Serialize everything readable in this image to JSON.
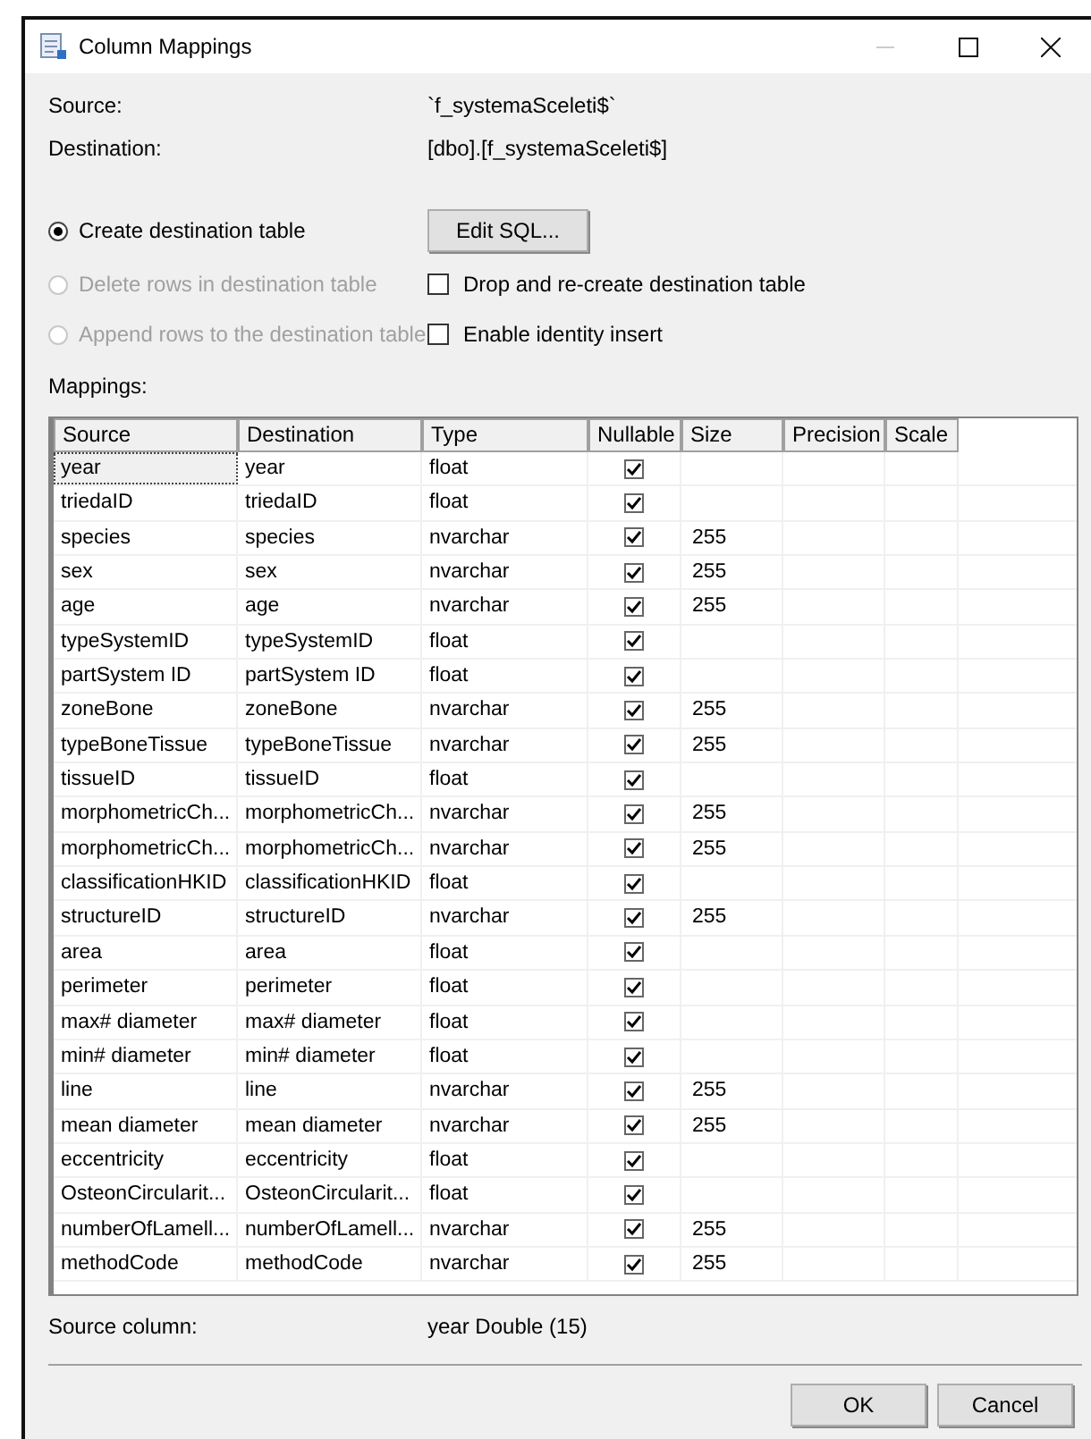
{
  "window": {
    "title": "Column Mappings"
  },
  "source": {
    "label": "Source:",
    "value": "`f_systemaSceleti$`"
  },
  "destination": {
    "label": "Destination:",
    "value": "[dbo].[f_systemaSceleti$]"
  },
  "options": [
    {
      "kind": "radio",
      "label": "Create destination table",
      "selected": true,
      "disabled": false
    },
    {
      "kind": "button",
      "label": "Edit SQL..."
    },
    {
      "kind": "radio",
      "label": "Delete rows in destination table",
      "selected": false,
      "disabled": true
    },
    {
      "kind": "checkbox",
      "label": "Drop and re-create destination table",
      "checked": false
    },
    {
      "kind": "radio",
      "label": "Append rows to the destination table",
      "selected": false,
      "disabled": true
    },
    {
      "kind": "checkbox",
      "label": "Enable identity insert",
      "checked": false
    }
  ],
  "mappings_label": "Mappings:",
  "table": {
    "columns": [
      "Source",
      "Destination",
      "Type",
      "Nullable",
      "Size",
      "Precision",
      "Scale"
    ],
    "rows": [
      {
        "source": "year",
        "destination": "year",
        "type": "float",
        "nullable": true,
        "size": "",
        "selected": true
      },
      {
        "source": "triedaID",
        "destination": "triedaID",
        "type": "float",
        "nullable": true,
        "size": "",
        "selected": false
      },
      {
        "source": "species",
        "destination": "species",
        "type": "nvarchar",
        "nullable": true,
        "size": "255",
        "selected": false
      },
      {
        "source": "sex",
        "destination": "sex",
        "type": "nvarchar",
        "nullable": true,
        "size": "255",
        "selected": false
      },
      {
        "source": "age",
        "destination": "age",
        "type": "nvarchar",
        "nullable": true,
        "size": "255",
        "selected": false
      },
      {
        "source": "typeSystemID",
        "destination": "typeSystemID",
        "type": "float",
        "nullable": true,
        "size": "",
        "selected": false
      },
      {
        "source": "partSystem ID",
        "destination": "partSystem ID",
        "type": "float",
        "nullable": true,
        "size": "",
        "selected": false
      },
      {
        "source": "zoneBone",
        "destination": "zoneBone",
        "type": "nvarchar",
        "nullable": true,
        "size": "255",
        "selected": false
      },
      {
        "source": "typeBoneTissue",
        "destination": "typeBoneTissue",
        "type": "nvarchar",
        "nullable": true,
        "size": "255",
        "selected": false
      },
      {
        "source": "tissueID",
        "destination": "tissueID",
        "type": "float",
        "nullable": true,
        "size": "",
        "selected": false
      },
      {
        "source": "morphometricCh...",
        "destination": "morphometricCh...",
        "type": "nvarchar",
        "nullable": true,
        "size": "255",
        "selected": false
      },
      {
        "source": "morphometricCh...",
        "destination": "morphometricCh...",
        "type": "nvarchar",
        "nullable": true,
        "size": "255",
        "selected": false
      },
      {
        "source": "classificationHKID",
        "destination": "classificationHKID",
        "type": "float",
        "nullable": true,
        "size": "",
        "selected": false
      },
      {
        "source": "structureID",
        "destination": "structureID",
        "type": "nvarchar",
        "nullable": true,
        "size": "255",
        "selected": false
      },
      {
        "source": "area",
        "destination": "area",
        "type": "float",
        "nullable": true,
        "size": "",
        "selected": false
      },
      {
        "source": "perimeter",
        "destination": "perimeter",
        "type": "float",
        "nullable": true,
        "size": "",
        "selected": false
      },
      {
        "source": "max# diameter",
        "destination": "max# diameter",
        "type": "float",
        "nullable": true,
        "size": "",
        "selected": false
      },
      {
        "source": "min# diameter",
        "destination": "min# diameter",
        "type": "float",
        "nullable": true,
        "size": "",
        "selected": false
      },
      {
        "source": "line",
        "destination": "line",
        "type": "nvarchar",
        "nullable": true,
        "size": "255",
        "selected": false
      },
      {
        "source": "mean diameter",
        "destination": "mean diameter",
        "type": "nvarchar",
        "nullable": true,
        "size": "255",
        "selected": false
      },
      {
        "source": "eccentricity",
        "destination": "eccentricity",
        "type": "float",
        "nullable": true,
        "size": "",
        "selected": false
      },
      {
        "source": "OsteonCircularit...",
        "destination": "OsteonCircularit...",
        "type": "float",
        "nullable": true,
        "size": "",
        "selected": false
      },
      {
        "source": "numberOfLamell...",
        "destination": "numberOfLamell...",
        "type": "nvarchar",
        "nullable": true,
        "size": "255",
        "selected": false
      },
      {
        "source": "methodCode",
        "destination": "methodCode",
        "type": "nvarchar",
        "nullable": true,
        "size": "255",
        "selected": false
      }
    ]
  },
  "source_column": {
    "label": "Source column:",
    "value": "year Double (15)"
  },
  "buttons": [
    "OK",
    "Cancel"
  ]
}
